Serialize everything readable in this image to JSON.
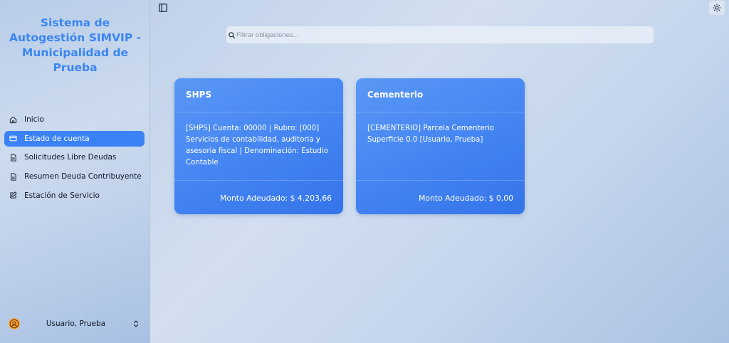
{
  "sidebar": {
    "title": "Sistema de Autogestión SIMVIP - Municipalidad de Prueba",
    "items": [
      {
        "label": "Inicio",
        "icon": "home-icon",
        "active": false
      },
      {
        "label": "Estado de cuenta",
        "icon": "credit-card-icon",
        "active": true
      },
      {
        "label": "Solicitudes Libre Deudas",
        "icon": "document-icon",
        "active": false
      },
      {
        "label": "Resumen Deuda Contribuyente",
        "icon": "document-icon",
        "active": false
      },
      {
        "label": "Estación de Servicio",
        "icon": "edit-icon",
        "active": false
      }
    ],
    "user": {
      "name": "Usuario, Prueba",
      "avatar_icon": "user-circle-icon"
    }
  },
  "header": {
    "sidebar_toggle_icon": "panel-left-icon",
    "theme_toggle_icon": "sun-icon"
  },
  "search": {
    "placeholder": "Filtrar obligaciones..."
  },
  "cards": [
    {
      "title": "SHPS",
      "description": "[SHPS] Cuenta: 00000 | Rubro: [000] Servicios de contabilidad, auditoria y asesoria fiscal | Denominación: Estudio Contable",
      "amount": "Monto Adeudado: $ 4.203,66"
    },
    {
      "title": "Cementerio",
      "description": "[CEMENTERIO] Parcela Cementerio Superficie 0.0 [Usuario, Prueba]",
      "amount": "Monto Adeudado: $ 0,00"
    }
  ],
  "colors": {
    "accent": "#3b82f6",
    "title": "#3a86f0",
    "card": "#4586f2",
    "avatar": "#f6a63a"
  }
}
